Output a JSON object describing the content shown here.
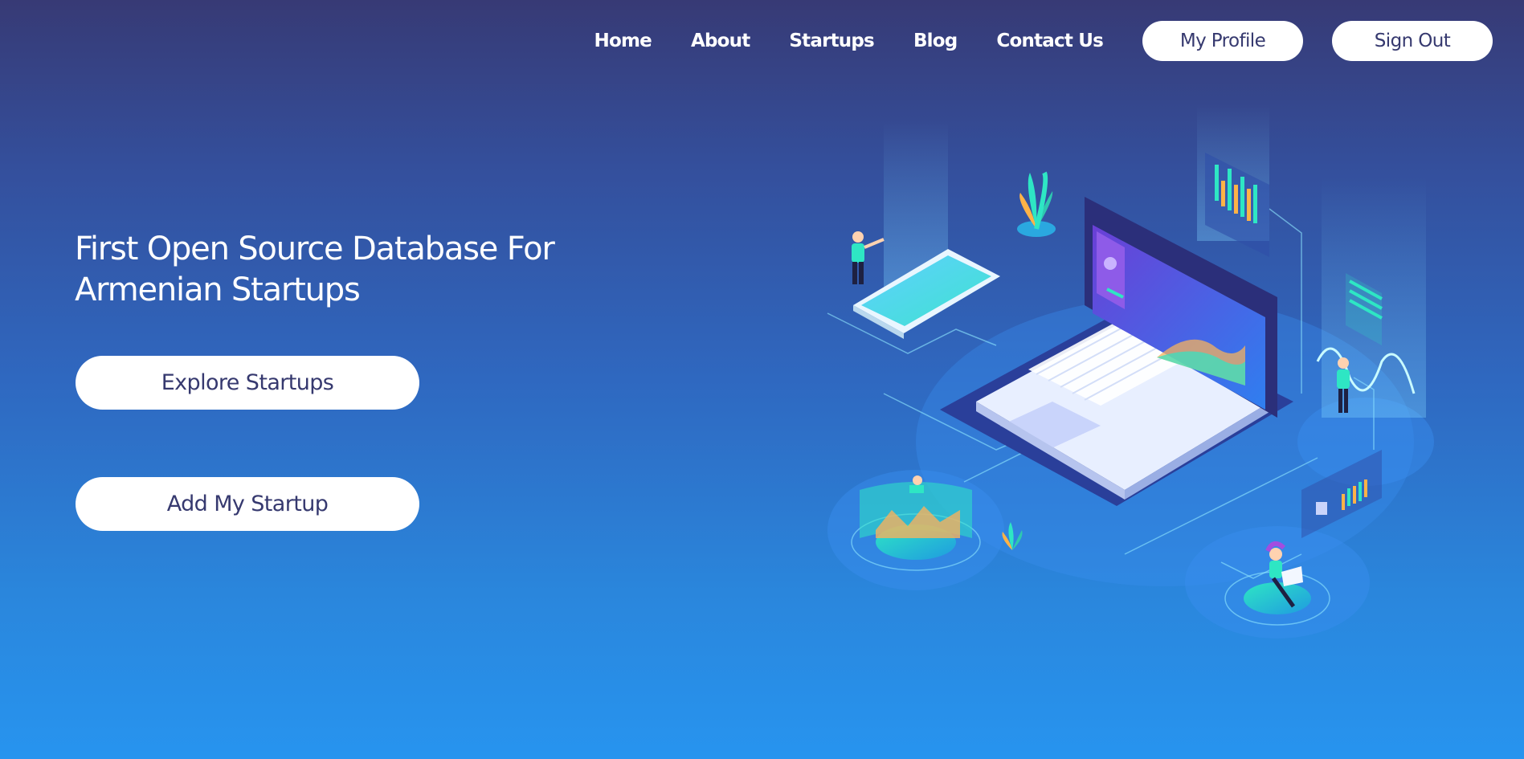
{
  "nav": {
    "links": [
      "Home",
      "About",
      "Startups",
      "Blog",
      "Contact Us"
    ],
    "profile_label": "My Profile",
    "signout_label": "Sign Out"
  },
  "hero": {
    "title_line1": "First Open Source Database For",
    "title_line2": "Armenian Startups",
    "explore_label": "Explore Startups",
    "add_label": "Add My Startup"
  },
  "colors": {
    "background_top": "#373a75",
    "background_bottom": "#2794ef",
    "button_bg": "#ffffff",
    "button_text": "#36396f",
    "accent_teal": "#2ee6c4"
  },
  "illustration": {
    "icon": "isometric-laptop-illustration"
  }
}
